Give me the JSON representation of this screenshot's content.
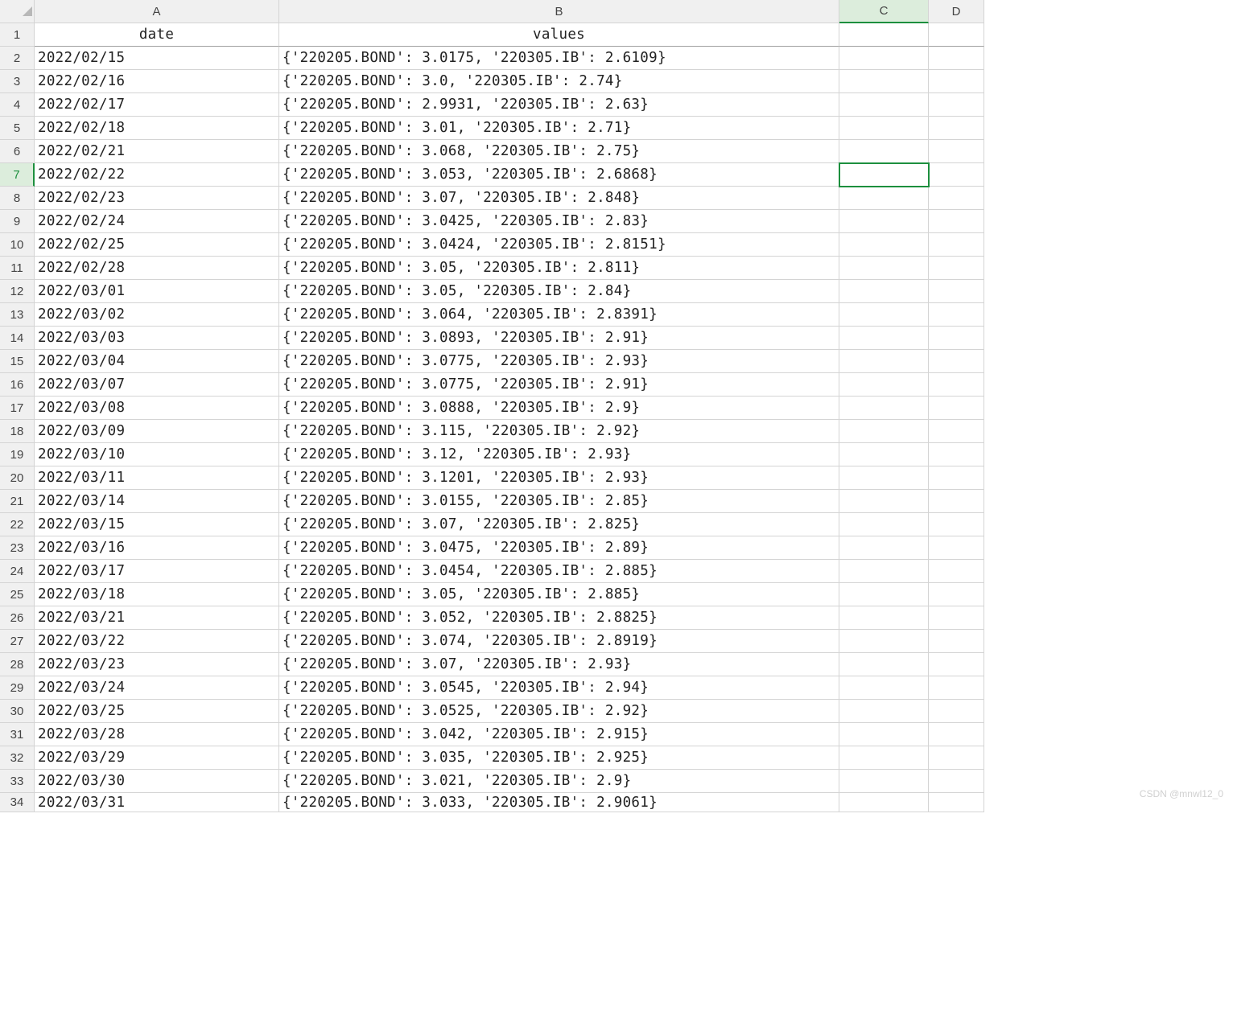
{
  "columns": [
    "A",
    "B",
    "C",
    "D"
  ],
  "headers": {
    "A": "date",
    "B": "values"
  },
  "selected_cell": {
    "row": 7,
    "col": "C"
  },
  "rows": [
    {
      "n": 1,
      "date": "",
      "values": ""
    },
    {
      "n": 2,
      "date": "2022/02/15",
      "values": "{'220205.BOND': 3.0175, '220305.IB': 2.6109}"
    },
    {
      "n": 3,
      "date": "2022/02/16",
      "values": "{'220205.BOND': 3.0, '220305.IB': 2.74}"
    },
    {
      "n": 4,
      "date": "2022/02/17",
      "values": "{'220205.BOND': 2.9931, '220305.IB': 2.63}"
    },
    {
      "n": 5,
      "date": "2022/02/18",
      "values": "{'220205.BOND': 3.01, '220305.IB': 2.71}"
    },
    {
      "n": 6,
      "date": "2022/02/21",
      "values": "{'220205.BOND': 3.068, '220305.IB': 2.75}"
    },
    {
      "n": 7,
      "date": "2022/02/22",
      "values": "{'220205.BOND': 3.053, '220305.IB': 2.6868}"
    },
    {
      "n": 8,
      "date": "2022/02/23",
      "values": "{'220205.BOND': 3.07, '220305.IB': 2.848}"
    },
    {
      "n": 9,
      "date": "2022/02/24",
      "values": "{'220205.BOND': 3.0425, '220305.IB': 2.83}"
    },
    {
      "n": 10,
      "date": "2022/02/25",
      "values": "{'220205.BOND': 3.0424, '220305.IB': 2.8151}"
    },
    {
      "n": 11,
      "date": "2022/02/28",
      "values": "{'220205.BOND': 3.05, '220305.IB': 2.811}"
    },
    {
      "n": 12,
      "date": "2022/03/01",
      "values": "{'220205.BOND': 3.05, '220305.IB': 2.84}"
    },
    {
      "n": 13,
      "date": "2022/03/02",
      "values": "{'220205.BOND': 3.064, '220305.IB': 2.8391}"
    },
    {
      "n": 14,
      "date": "2022/03/03",
      "values": "{'220205.BOND': 3.0893, '220305.IB': 2.91}"
    },
    {
      "n": 15,
      "date": "2022/03/04",
      "values": "{'220205.BOND': 3.0775, '220305.IB': 2.93}"
    },
    {
      "n": 16,
      "date": "2022/03/07",
      "values": "{'220205.BOND': 3.0775, '220305.IB': 2.91}"
    },
    {
      "n": 17,
      "date": "2022/03/08",
      "values": "{'220205.BOND': 3.0888, '220305.IB': 2.9}"
    },
    {
      "n": 18,
      "date": "2022/03/09",
      "values": "{'220205.BOND': 3.115, '220305.IB': 2.92}"
    },
    {
      "n": 19,
      "date": "2022/03/10",
      "values": "{'220205.BOND': 3.12, '220305.IB': 2.93}"
    },
    {
      "n": 20,
      "date": "2022/03/11",
      "values": "{'220205.BOND': 3.1201, '220305.IB': 2.93}"
    },
    {
      "n": 21,
      "date": "2022/03/14",
      "values": "{'220205.BOND': 3.0155, '220305.IB': 2.85}"
    },
    {
      "n": 22,
      "date": "2022/03/15",
      "values": "{'220205.BOND': 3.07, '220305.IB': 2.825}"
    },
    {
      "n": 23,
      "date": "2022/03/16",
      "values": "{'220205.BOND': 3.0475, '220305.IB': 2.89}"
    },
    {
      "n": 24,
      "date": "2022/03/17",
      "values": "{'220205.BOND': 3.0454, '220305.IB': 2.885}"
    },
    {
      "n": 25,
      "date": "2022/03/18",
      "values": "{'220205.BOND': 3.05, '220305.IB': 2.885}"
    },
    {
      "n": 26,
      "date": "2022/03/21",
      "values": "{'220205.BOND': 3.052, '220305.IB': 2.8825}"
    },
    {
      "n": 27,
      "date": "2022/03/22",
      "values": "{'220205.BOND': 3.074, '220305.IB': 2.8919}"
    },
    {
      "n": 28,
      "date": "2022/03/23",
      "values": "{'220205.BOND': 3.07, '220305.IB': 2.93}"
    },
    {
      "n": 29,
      "date": "2022/03/24",
      "values": "{'220205.BOND': 3.0545, '220305.IB': 2.94}"
    },
    {
      "n": 30,
      "date": "2022/03/25",
      "values": "{'220205.BOND': 3.0525, '220305.IB': 2.92}"
    },
    {
      "n": 31,
      "date": "2022/03/28",
      "values": "{'220205.BOND': 3.042, '220305.IB': 2.915}"
    },
    {
      "n": 32,
      "date": "2022/03/29",
      "values": "{'220205.BOND': 3.035, '220305.IB': 2.925}"
    },
    {
      "n": 33,
      "date": "2022/03/30",
      "values": "{'220205.BOND': 3.021, '220305.IB': 2.9}"
    },
    {
      "n": 34,
      "date": "2022/03/31",
      "values": "{'220205.BOND': 3.033, '220305.IB': 2.9061}"
    }
  ],
  "watermark": "CSDN @mnwl12_0"
}
